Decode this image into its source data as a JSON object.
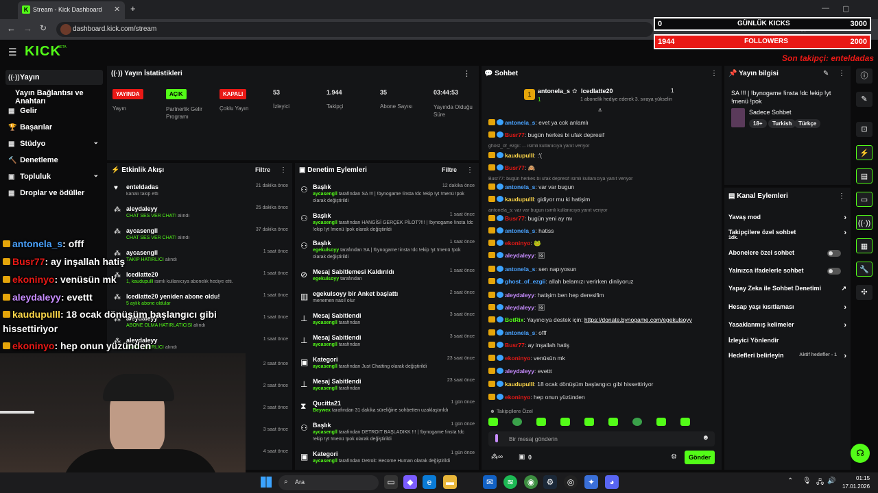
{
  "colors": {
    "accent": "#53fc18",
    "red": "#e91916",
    "panel": "#141517"
  },
  "browser": {
    "tab_title": "Stream - Kick Dashboard",
    "url": "dashboard.kick.com/stream"
  },
  "overlay": {
    "kicks_label": "GÜNLÜK KICKS",
    "kicks_left": "0",
    "kicks_right": "3000",
    "followers_label": "FOLLOWERS",
    "followers_left": "1944",
    "followers_right": "2000",
    "last_follower": "Son takipçi: enteldadas"
  },
  "kick": {
    "logo": "KICK",
    "beta": "BETA"
  },
  "sidebar": {
    "items": [
      {
        "label": "Yayın",
        "icon": "broadcast-icon"
      },
      {
        "label": "Yayın Bağlantısı ve Anahtarı"
      },
      {
        "label": "Gelir",
        "icon": "money-icon"
      },
      {
        "label": "Başarılar",
        "icon": "trophy-icon"
      },
      {
        "label": "Stüdyo",
        "icon": "studio-icon"
      },
      {
        "label": "Denetleme",
        "icon": "hammer-icon"
      },
      {
        "label": "Topluluk",
        "icon": "community-icon"
      },
      {
        "label": "Droplar ve ödüller",
        "icon": "drops-icon"
      }
    ]
  },
  "stats": {
    "title": "Yayın İstatistikleri",
    "cells": [
      {
        "badge": "YAYINDA",
        "label": "Yayın"
      },
      {
        "badge": "AÇIK",
        "label": "Partnerlik Gelir Programı"
      },
      {
        "badge": "KAPALI",
        "label": "Çoklu Yayın"
      },
      {
        "value": "53",
        "label": "İzleyici"
      },
      {
        "value": "1.944",
        "label": "Takipçi"
      },
      {
        "value": "35",
        "label": "Abone Sayısı"
      },
      {
        "value": "03:44:53",
        "label": "Yayında Olduğu Süre"
      }
    ]
  },
  "activity": {
    "title": "Etkinlik Akışı",
    "filter": "Filtre",
    "rows": [
      {
        "name": "enteldadas",
        "sub": "kanalı takip etti",
        "time": "21 dakika önce"
      },
      {
        "name": "aleydaleyy",
        "sub": "CHAT SES VER CHAT!",
        "sub2": "alındı",
        "time": "25 dakika önce"
      },
      {
        "name": "aycasengll",
        "sub": "CHAT SES VER CHAT!",
        "sub2": "alındı",
        "time": "37 dakika önce"
      },
      {
        "name": "aycasengll",
        "sub": "TAKİP HATIRLICI",
        "sub2": "alındı",
        "time": "1 saat önce"
      },
      {
        "name": "Icedlatte20",
        "sub": "1, kaudupulll",
        "sub2": "isimli kullanıcıya abonelik hediye etti.",
        "time": "1 saat önce"
      },
      {
        "name": "Icedlatte20 yeniden abone oldu!",
        "sub": "5 aylık abone oldular",
        "time": "1 saat önce"
      },
      {
        "name": "aleydaleyy",
        "sub": "ABONE OLMA HATIRLATICISI",
        "sub2": "alındı",
        "time": "1 saat önce"
      },
      {
        "name": "aleydaleyy",
        "sub": "TAKİP HATIRLICI",
        "sub2": "alındı",
        "time": "1 saat önce"
      }
    ],
    "extra_times": [
      "2 saat önce",
      "2 saat önce",
      "2 saat önce",
      "3 saat önce",
      "4 saat önce"
    ]
  },
  "moderation": {
    "title": "Denetim Eylemleri",
    "filter": "Filtre",
    "rows": [
      {
        "title": "Başlık",
        "user": "aycasengll",
        "text": "tarafından SA !!! | !bynogame !insta !dc !ekip !yt !menü !pok olarak değiştirildi",
        "time": "12 dakika önce"
      },
      {
        "title": "Başlık",
        "user": "aycasengll",
        "text": "tarafından HANGİSİ GERÇEK PİLOT?!!! | !bynogame !insta !dc !ekip !yt !menü !pok olarak değiştirildi",
        "time": "1 saat önce"
      },
      {
        "title": "Başlık",
        "user": "egekulsoyy",
        "text": "tarafından SA | !bynogame !insta !dc !ekip !yt !menü !pok olarak değiştirildi",
        "time": "1 saat önce"
      },
      {
        "title": "Mesaj Sabitlemesi Kaldırıldı",
        "user": "egekulsoyy",
        "text": "tarafından",
        "time": "1 saat önce"
      },
      {
        "title": "egekulsoyy bir Anket başlattı",
        "user": "",
        "text": "menemen nasıl olur",
        "time": "2 saat önce"
      },
      {
        "title": "Mesaj Sabitlendi",
        "user": "aycasengll",
        "text": "tarafından",
        "time": "3 saat önce"
      },
      {
        "title": "Mesaj Sabitlendi",
        "user": "aycasengll",
        "text": "tarafından",
        "time": "3 saat önce"
      },
      {
        "title": "Kategori",
        "user": "aycasengll",
        "text": "tarafından Just Chatting olarak değiştirildi",
        "time": "23 saat önce"
      },
      {
        "title": "Mesaj Sabitlendi",
        "user": "aycasengll",
        "text": "tarafından",
        "time": "23 saat önce"
      },
      {
        "title": "Qucitta21",
        "user": "Beywex",
        "text": "tarafından 31 dakika süreliğine sohbetten uzaklaştırıldı",
        "time": "1 gün önce"
      },
      {
        "title": "Başlık",
        "user": "aycasengll",
        "text": "tarafından DETROIT BAŞLADIKK !!! | !bynogame !insta !dc !ekip !yt !menü !pok olarak değiştirildi",
        "time": "1 gün önce"
      },
      {
        "title": "Kategori",
        "user": "aycasengll",
        "text": "tarafından Detroit: Become Human olarak değiştirildi",
        "time": "1 gün önce"
      }
    ]
  },
  "chat": {
    "title": "Sohbet",
    "gift_from": "antonela_s",
    "gift_to": "Icedlatte20",
    "gift_count1": "1",
    "gift_count2": "1",
    "gift_text": "1 abonelik hediye ederek 3. sıraya yükselin",
    "messages": [
      {
        "user": "antonela_s",
        "color": "#4aa3ff",
        "text": "evet ya cok anlamlı"
      },
      {
        "user": "Busr77",
        "color": "#e91916",
        "text": "bugün herkes bi ufak depresif"
      },
      {
        "reply": "ghost_of_ezgii: ... isimli kullanıcıya yanıt veriyor"
      },
      {
        "user": "kaudupulll",
        "color": "#ffd84a",
        "text": ":'("
      },
      {
        "user": "Busr77",
        "color": "#e91916",
        "text": "🙈"
      },
      {
        "reply": "Busr77: bugün herkes bi ufak depresif isimli kullanıcıya yanıt veriyor"
      },
      {
        "user": "antonela_s",
        "color": "#4aa3ff",
        "text": "var var bugun"
      },
      {
        "user": "kaudupulll",
        "color": "#ffd84a",
        "text": "gidiyor mu ki hatişim"
      },
      {
        "reply": "antonela_s: var var bugun isimli kullanıcıya yanıt veriyor"
      },
      {
        "user": "Busr77",
        "color": "#e91916",
        "text": "bugün yeni ay mı"
      },
      {
        "user": "antonela_s",
        "color": "#4aa3ff",
        "text": "hatiss"
      },
      {
        "user": "ekoninyo",
        "color": "#e91916",
        "text": "🐸"
      },
      {
        "user": "aleydaleyy",
        "color": "#c78cff",
        "text": "🖼"
      },
      {
        "user": "antonela_s",
        "color": "#4aa3ff",
        "text": "sen napıyosun"
      },
      {
        "user": "ghost_of_ezgii",
        "color": "#4aa3ff",
        "text": "allah belamızı verirken dinliyoruz"
      },
      {
        "user": "aleydaleyy",
        "color": "#c78cff",
        "text": "hatişim ben hep deresifim"
      },
      {
        "user": "aleydaleyy",
        "color": "#c78cff",
        "text": "🖼"
      },
      {
        "user": "BotRix",
        "color": "#53fc18",
        "text": "Yayıncıya destek için: ",
        "link": "https://donate.bynogame.com/egekulsoyy"
      },
      {
        "user": "antonela_s",
        "color": "#4aa3ff",
        "text": "offf"
      },
      {
        "user": "Busr77",
        "color": "#e91916",
        "text": "ay inşallah hatiş"
      },
      {
        "user": "ekoninyo",
        "color": "#e91916",
        "text": "venüsün mk"
      },
      {
        "user": "aleydaleyy",
        "color": "#c78cff",
        "text": "evettt"
      },
      {
        "user": "kaudupulll",
        "color": "#ffd84a",
        "text": "18 ocak dönüşüm başlangıcı gibi hissettiriyor"
      },
      {
        "user": "ekoninyo",
        "color": "#e91916",
        "text": "hep onun yüzünden"
      }
    ],
    "emote_label": "Takipçilere Özel",
    "placeholder": "Bir mesaj gönderin",
    "points": "0",
    "send": "Gönder"
  },
  "stream_info": {
    "title": "Yayın bilgisi",
    "stream_title": "SA !!! | !bynogame !insta !dc !ekip !yt !menü !pok",
    "category": "Sadece Sohbet",
    "tags": [
      "18+",
      "Turkish",
      "Türkçe"
    ]
  },
  "channel_actions": {
    "title": "Kanal Eylemleri",
    "items": [
      {
        "label": "Yavaş mod",
        "type": "arrow"
      },
      {
        "label": "Takipçilere özel sohbet",
        "sub": "1dk.",
        "type": "arrow"
      },
      {
        "label": "Abonelere özel sohbet",
        "type": "toggle"
      },
      {
        "label": "Yalnızca ifadelerle sohbet",
        "type": "toggle"
      },
      {
        "label": "Yapay Zeka ile Sohbet Denetimi",
        "type": "ext"
      },
      {
        "label": "Hesap yaşı kısıtlaması",
        "type": "arrow"
      },
      {
        "label": "Yasaklanmış kelimeler",
        "type": "arrow"
      },
      {
        "label": "İzleyici Yönlendir",
        "type": "none"
      },
      {
        "label": "Hedefleri belirleyin",
        "sub": "Aktif hedefler - 1",
        "type": "arrow"
      }
    ]
  },
  "stream_overlay_chat": [
    {
      "user": "antonela_s",
      "color": "#4aa3ff",
      "text": ": offf"
    },
    {
      "user": "Busr77",
      "color": "#e91916",
      "text": ": ay inşallah hatiş"
    },
    {
      "user": "ekoninyo",
      "color": "#e91916",
      "text": ": venüsün mk"
    },
    {
      "user": "aleydaleyy",
      "color": "#c78cff",
      "text": ": evettt"
    },
    {
      "user": "kaudupulll",
      "color": "#ffd84a",
      "text": ": 18 ocak dönüşüm başlangıcı gibi"
    },
    {
      "user": "",
      "color": "#fff",
      "text": "hissettiriyor"
    },
    {
      "user": "ekoninyo",
      "color": "#e91916",
      "text": ": hep onun yüzünden"
    }
  ],
  "taskbar": {
    "search": "Ara",
    "time": "01:15",
    "date": "17.01.2026"
  }
}
